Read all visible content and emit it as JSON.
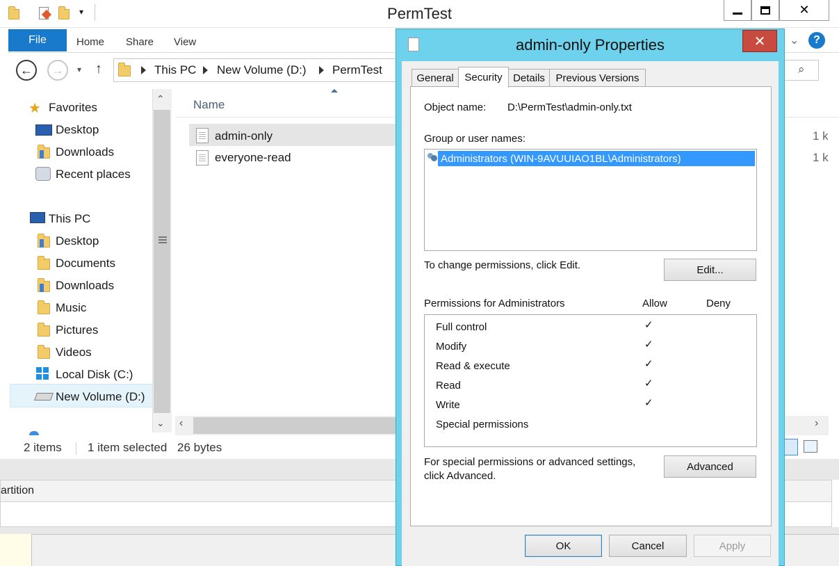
{
  "explorer": {
    "title": "PermTest",
    "ribbon_tabs": [
      "File",
      "Home",
      "Share",
      "View"
    ],
    "address": [
      "This PC",
      "New Volume (D:)",
      "PermTest"
    ],
    "nav": {
      "favorites": "Favorites",
      "favorites_items": [
        "Desktop",
        "Downloads",
        "Recent places"
      ],
      "this_pc": "This PC",
      "this_pc_items": [
        "Desktop",
        "Documents",
        "Downloads",
        "Music",
        "Pictures",
        "Videos",
        "Local Disk (C:)",
        "New Volume (D:)"
      ]
    },
    "column_header": "Name",
    "files": [
      {
        "name": "admin-only",
        "size": "1 k",
        "selected": true
      },
      {
        "name": "everyone-read",
        "size": "1 k",
        "selected": false
      }
    ],
    "status": {
      "items": "2 items",
      "selected": "1 item selected",
      "size": "26 bytes"
    }
  },
  "background": {
    "header_text": "artition"
  },
  "dialog": {
    "title": "admin-only Properties",
    "tabs": [
      "General",
      "Security",
      "Details",
      "Previous Versions"
    ],
    "active_tab": "Security",
    "object_name_label": "Object name:",
    "object_name": "D:\\PermTest\\admin-only.txt",
    "group_label": "Group or user names:",
    "users": [
      "Administrators (WIN-9AVUUIAO1BL\\Administrators)"
    ],
    "change_text": "To change permissions, click Edit.",
    "edit_button": "Edit...",
    "permissions_label": "Permissions for Administrators",
    "allow_header": "Allow",
    "deny_header": "Deny",
    "permissions": [
      {
        "name": "Full control",
        "allow": true,
        "deny": false
      },
      {
        "name": "Modify",
        "allow": true,
        "deny": false
      },
      {
        "name": "Read & execute",
        "allow": true,
        "deny": false
      },
      {
        "name": "Read",
        "allow": true,
        "deny": false
      },
      {
        "name": "Write",
        "allow": true,
        "deny": false
      },
      {
        "name": "Special permissions",
        "allow": false,
        "deny": false
      }
    ],
    "check_mark": "✓",
    "advanced_text_1": "For special permissions or advanced settings,",
    "advanced_text_2": "click Advanced.",
    "advanced_button": "Advanced",
    "ok_button": "OK",
    "cancel_button": "Cancel",
    "apply_button": "Apply"
  },
  "colors": {
    "accent": "#1979ca",
    "dialog_frame": "#6fd2ec",
    "selection": "#3399ff",
    "close": "#c94a3f"
  }
}
